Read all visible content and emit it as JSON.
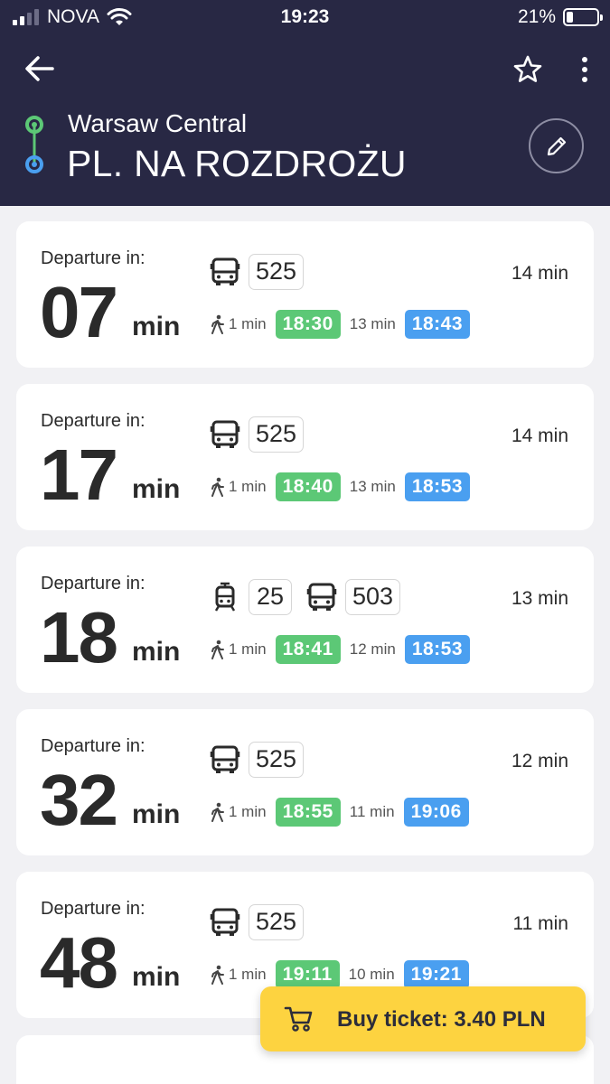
{
  "status_bar": {
    "carrier": "NOVA",
    "time": "19:23",
    "battery": "21%",
    "battery_level": 0.21
  },
  "header": {
    "origin": "Warsaw Central",
    "destination": "PL. NA ROZDROŻU"
  },
  "departure_label": "Departure in:",
  "unit_label": "min",
  "departures": [
    {
      "minutes": "07",
      "lines": [
        {
          "type": "bus",
          "number": "525"
        }
      ],
      "duration": "14 min",
      "walk": "1 min",
      "depart_time": "18:30",
      "ride": "13 min",
      "arrive_time": "18:43"
    },
    {
      "minutes": "17",
      "lines": [
        {
          "type": "bus",
          "number": "525"
        }
      ],
      "duration": "14 min",
      "walk": "1 min",
      "depart_time": "18:40",
      "ride": "13 min",
      "arrive_time": "18:53"
    },
    {
      "minutes": "18",
      "lines": [
        {
          "type": "tram",
          "number": "25"
        },
        {
          "type": "bus",
          "number": "503"
        }
      ],
      "duration": "13 min",
      "walk": "1 min",
      "depart_time": "18:41",
      "ride": "12 min",
      "arrive_time": "18:53"
    },
    {
      "minutes": "32",
      "lines": [
        {
          "type": "bus",
          "number": "525"
        }
      ],
      "duration": "12 min",
      "walk": "1 min",
      "depart_time": "18:55",
      "ride": "11 min",
      "arrive_time": "19:06"
    },
    {
      "minutes": "48",
      "lines": [
        {
          "type": "bus",
          "number": "525"
        }
      ],
      "duration": "11 min",
      "walk": "1 min",
      "depart_time": "19:11",
      "ride": "10 min",
      "arrive_time": "19:21"
    }
  ],
  "buy_button": {
    "label": "Buy ticket: 3.40 PLN"
  },
  "colors": {
    "header_bg": "#282844",
    "depart_badge": "#5cc876",
    "arrive_badge": "#4a9ff0",
    "buy_button": "#fdd340",
    "origin_dot": "#5cc876",
    "destination_dot": "#4a9ff0"
  },
  "icons": {
    "back": "arrow-left-icon",
    "favorite": "star-icon",
    "more": "more-vertical-icon",
    "edit": "pencil-icon",
    "bus": "bus-icon",
    "tram": "tram-icon",
    "walk": "walk-icon",
    "cart": "cart-icon"
  }
}
